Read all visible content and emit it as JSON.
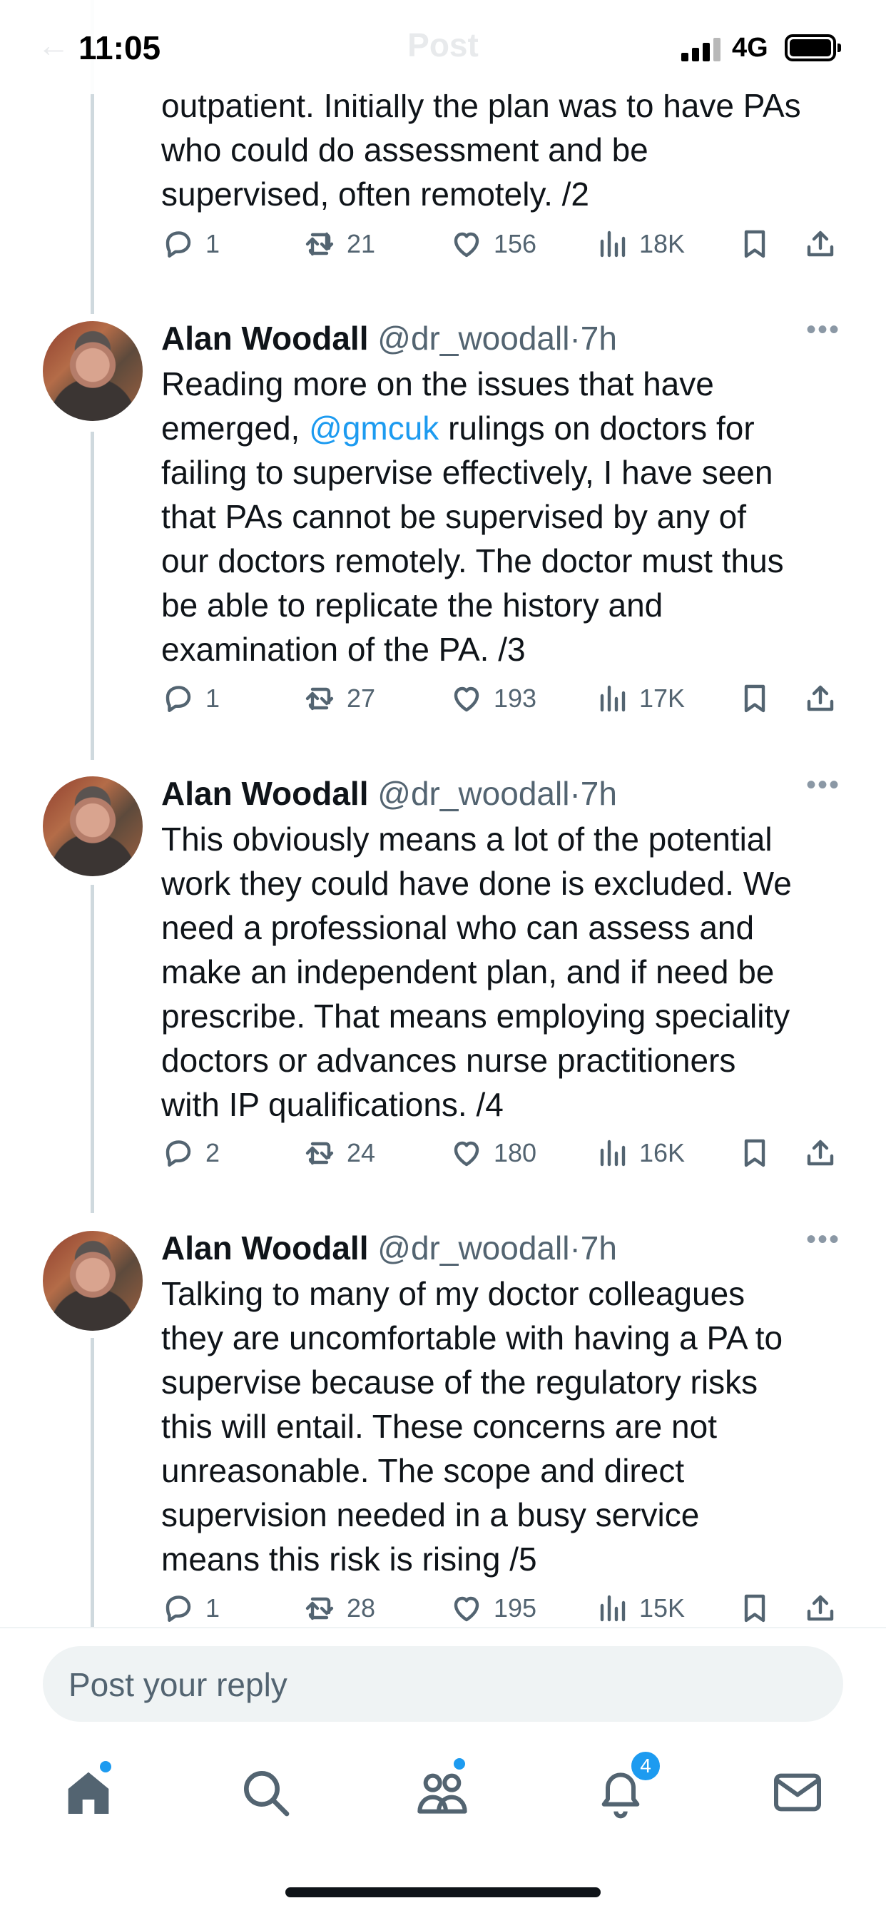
{
  "status_bar": {
    "time": "11:05",
    "network": "4G"
  },
  "header": {
    "title": "Post"
  },
  "author": {
    "name": "Alan Woodall",
    "handle": "@dr_woodall",
    "time": "7h",
    "separator": "·"
  },
  "tweets": [
    {
      "lines": [
        "outpatient. Initially the plan was to have PAs",
        "who could do assessment and be",
        "supervised, often remotely. /2"
      ],
      "replies": "1",
      "reposts": "21",
      "likes": "156",
      "views": "18K"
    },
    {
      "line1": "Reading more on the issues that have",
      "line2_prefix": "emerged, ",
      "mention": "@gmcuk",
      "line2_suffix": " rulings on doctors for",
      "lines": [
        "failing to supervise effectively, I have seen",
        "that PAs cannot be supervised by any of",
        "our doctors remotely. The doctor must thus",
        "be able to replicate the history and",
        "examination of the PA. /3"
      ],
      "replies": "1",
      "reposts": "27",
      "likes": "193",
      "views": "17K"
    },
    {
      "lines": [
        "This obviously means a lot of the potential",
        "work they could have done is excluded. We",
        "need a professional who can assess and",
        "make an independent plan, and if need be",
        "prescribe. That means employing speciality",
        "doctors or advances nurse practitioners",
        "with IP qualifications. /4"
      ],
      "replies": "2",
      "reposts": "24",
      "likes": "180",
      "views": "16K"
    },
    {
      "lines": [
        "Talking to many of my doctor colleagues",
        "they are uncomfortable with having a PA to",
        "supervise because of the regulatory risks",
        "this will entail. These concerns are not",
        "unreasonable. The scope and direct",
        "supervision needed in a busy service",
        "means this risk is rising /5"
      ],
      "replies": "1",
      "reposts": "28",
      "likes": "195",
      "views": "15K"
    }
  ],
  "reply_bar": {
    "placeholder": "Post your reply"
  },
  "tabbar": {
    "notifications_count": "4"
  },
  "colors": {
    "accent": "#1d9bf0",
    "text": "#0f1419",
    "muted": "#536471",
    "line": "#cfd9de"
  }
}
